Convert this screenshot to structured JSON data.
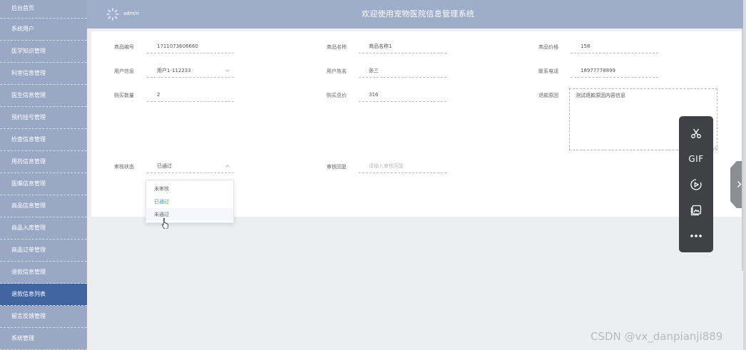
{
  "sidebar": {
    "items": [
      {
        "label": "后台首页"
      },
      {
        "label": "系统用户"
      },
      {
        "label": "医学知识管理"
      },
      {
        "label": "科室信息管理"
      },
      {
        "label": "医生信息管理"
      },
      {
        "label": "预约挂号管理"
      },
      {
        "label": "检查信息管理"
      },
      {
        "label": "用药信息管理"
      },
      {
        "label": "医嘱信息管理"
      },
      {
        "label": "商品信息管理"
      },
      {
        "label": "商品入库管理"
      },
      {
        "label": "商品订单管理"
      },
      {
        "label": "退款信息管理"
      },
      {
        "label": "退款信息列表"
      },
      {
        "label": "留言反馈管理"
      },
      {
        "label": "系统管理"
      }
    ],
    "active_index": 13
  },
  "header": {
    "username": "admin",
    "title": "欢迎使用宠物医院信息管理系统"
  },
  "form": {
    "product_no": {
      "label": "商品编号",
      "value": "1711073606660"
    },
    "product_name": {
      "label": "商品名称",
      "value": "商品名称1"
    },
    "product_price": {
      "label": "商品价格",
      "value": "158"
    },
    "user_info": {
      "label": "用户信息",
      "value": "用户1-112233"
    },
    "user_name": {
      "label": "用户姓名",
      "value": "张三"
    },
    "phone": {
      "label": "联系电话",
      "value": "18977778899"
    },
    "quantity": {
      "label": "购买数量",
      "value": "2"
    },
    "total": {
      "label": "购买总价",
      "value": "316"
    },
    "refund_reason": {
      "label": "退款原因",
      "value": "测试退款原因内容信息"
    },
    "review_status": {
      "label": "审核状态",
      "value": "已通过"
    },
    "review_reply": {
      "label": "审核回复",
      "placeholder": "请输入审核回复"
    }
  },
  "dropdown": {
    "options": [
      {
        "label": "未审核"
      },
      {
        "label": "已通过"
      },
      {
        "label": "未通过"
      }
    ],
    "selected_index": 1,
    "hovered_index": 2
  },
  "toolbar": {
    "items": [
      {
        "icon": "scissors-icon"
      },
      {
        "icon": "gif-icon",
        "text": "GIF"
      },
      {
        "icon": "record-icon"
      },
      {
        "icon": "image-icon"
      },
      {
        "icon": "more-icon"
      }
    ]
  },
  "watermark": "CSDN @vx_danpianji889",
  "colors": {
    "sidebar_bg": "#9aa8c5",
    "sidebar_active": "#41639f",
    "header_bg": "#9eadc9",
    "toolbar_bg": "#3f4144",
    "selected_option": "#3a8ee6"
  }
}
